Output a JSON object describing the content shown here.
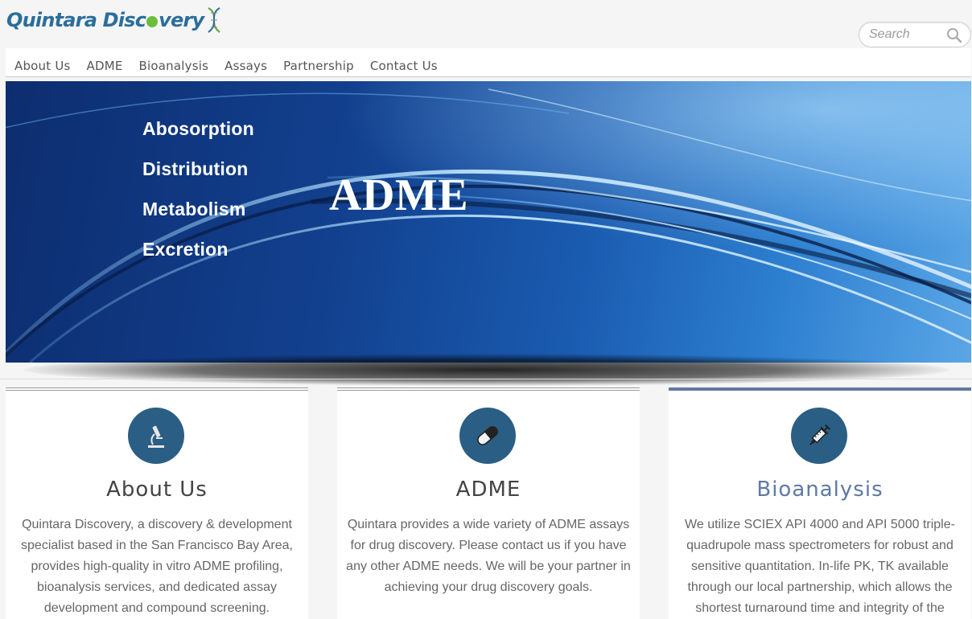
{
  "brand": {
    "name_part1": "Quintara Disc",
    "name_part2": "very"
  },
  "search": {
    "placeholder": "Search"
  },
  "nav": {
    "items": [
      {
        "label": "About Us"
      },
      {
        "label": "ADME"
      },
      {
        "label": "Bioanalysis"
      },
      {
        "label": "Assays"
      },
      {
        "label": "Partnership"
      },
      {
        "label": "Contact Us"
      }
    ]
  },
  "hero": {
    "list": [
      "Abosorption",
      "Distribution",
      "Metabolism",
      "Excretion"
    ],
    "title": "ADME"
  },
  "cards": [
    {
      "icon": "microscope-icon",
      "title": "About Us",
      "text": "Quintara Discovery, a discovery & development specialist based in the San Francisco Bay Area, provides high-quality in vitro ADME profiling, bioanalysis services, and dedicated assay development and compound screening."
    },
    {
      "icon": "pill-icon",
      "title": "ADME",
      "text": "Quintara provides a wide variety of ADME assays for drug discovery. Please contact us if you have any other ADME needs. We will be your partner in achieving your drug discovery goals."
    },
    {
      "icon": "syringe-icon",
      "title": "Bioanalysis",
      "text": "We utilize SCIEX API 4000 and API 5000 triple-quadrupole mass spectrometers for robust and sensitive quantitation. In-life PK, TK available through our local partnership, which allows the shortest turnaround time and integrity of the"
    }
  ],
  "colors": {
    "accent": "#5f79a3",
    "icon_circle": "#2b5e84",
    "brand_blue": "#2a6e9c",
    "brand_green": "#5aa33a"
  }
}
